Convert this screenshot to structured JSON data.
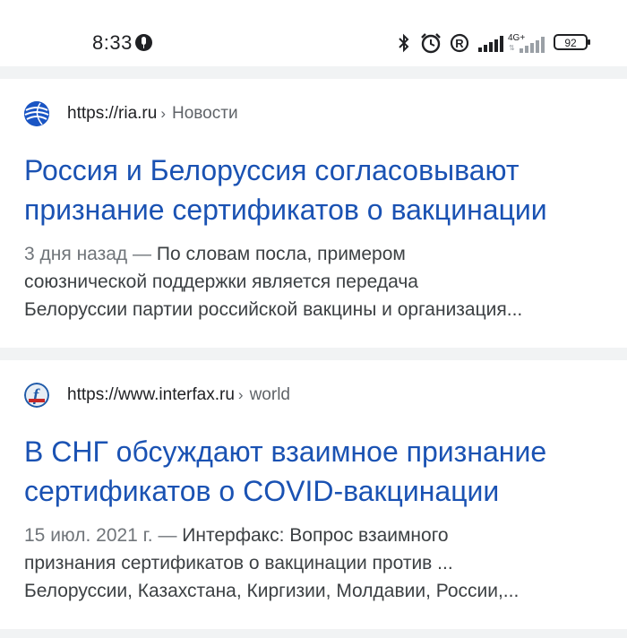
{
  "status_bar": {
    "time": "8:33",
    "network": "4G+",
    "battery": "92",
    "icons": [
      "microphone-icon",
      "bluetooth-icon",
      "alarm-icon",
      "roaming-r-icon",
      "signal-icon",
      "signal-4g-icon",
      "battery-icon"
    ]
  },
  "results": [
    {
      "favicon": "ria-globe-icon",
      "url": "https://ria.ru",
      "separator": "›",
      "crumb": "Новости",
      "title_lines": [
        "Россия и Белоруссия согласовывают",
        "признание сертификатов о вакцинации"
      ],
      "date": "3 дня назад",
      "dash": " — ",
      "snippet_lines": [
        "По словам посла, примером",
        "союзнической поддержки является передача",
        "Белоруссии партии российской вакцины и организация..."
      ]
    },
    {
      "favicon": "interfax-icon",
      "url": "https://www.interfax.ru",
      "separator": "›",
      "crumb": "world",
      "title_lines": [
        "В СНГ обсуждают взаимное признание",
        "сертификатов о COVID-вакцинации"
      ],
      "date": "15 июл. 2021 г.",
      "dash": " — ",
      "snippet_lines": [
        "Интерфакс: Вопрос взаимного",
        "признания сертификатов о вакцинации против ...",
        "Белоруссии, Казахстана, Киргизии, Молдавии, России,..."
      ]
    }
  ],
  "colors": {
    "link": "#1a52b3",
    "text": "#202124",
    "muted": "#70757a",
    "background": "#f1f3f4"
  }
}
